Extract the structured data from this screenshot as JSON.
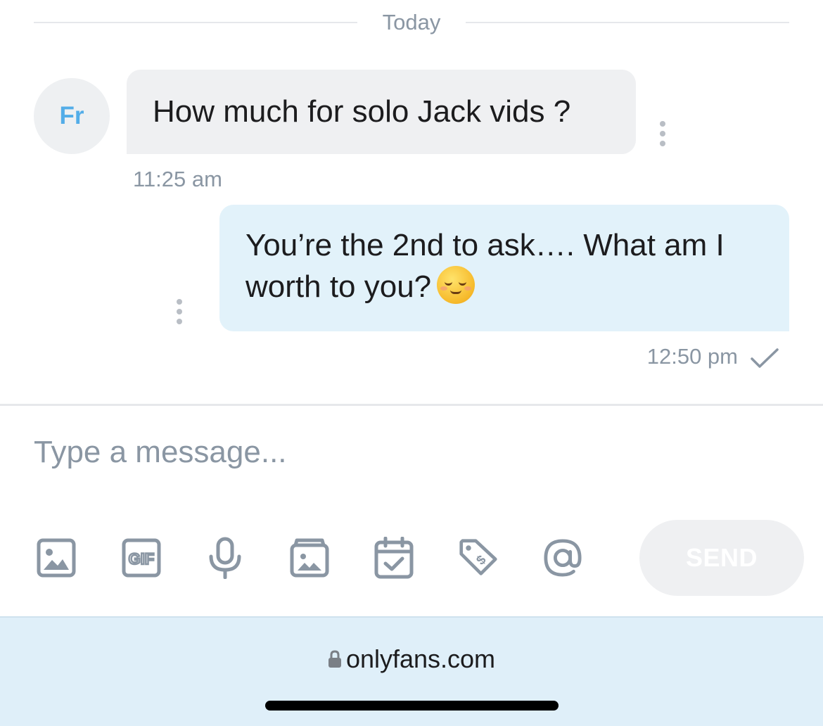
{
  "date_divider": "Today",
  "incoming": {
    "avatar_initials": "Fr",
    "text": "How much for solo Jack vids ?",
    "time": "11:25 am"
  },
  "outgoing": {
    "text_line1": "You’re the 2nd to ask…. What am I",
    "text_line2": "worth to you?",
    "emoji": "relieved-face",
    "time": "12:50 pm",
    "status_icon": "check-icon"
  },
  "composer": {
    "placeholder": "Type a message...",
    "toolbar": [
      "image-icon",
      "gif-icon",
      "microphone-icon",
      "vault-icon",
      "schedule-icon",
      "price-tag-icon",
      "mention-icon"
    ],
    "gif_label": "GIF",
    "send_label": "SEND"
  },
  "browser": {
    "url": "onlyfans.com"
  },
  "colors": {
    "accent": "#00aeef",
    "avatar_text": "#53ade8",
    "incoming_bubble": "#eff0f2",
    "outgoing_bubble": "#e2f2fa",
    "muted_text": "#8a96a3",
    "icon_gray": "#8a96a3"
  }
}
